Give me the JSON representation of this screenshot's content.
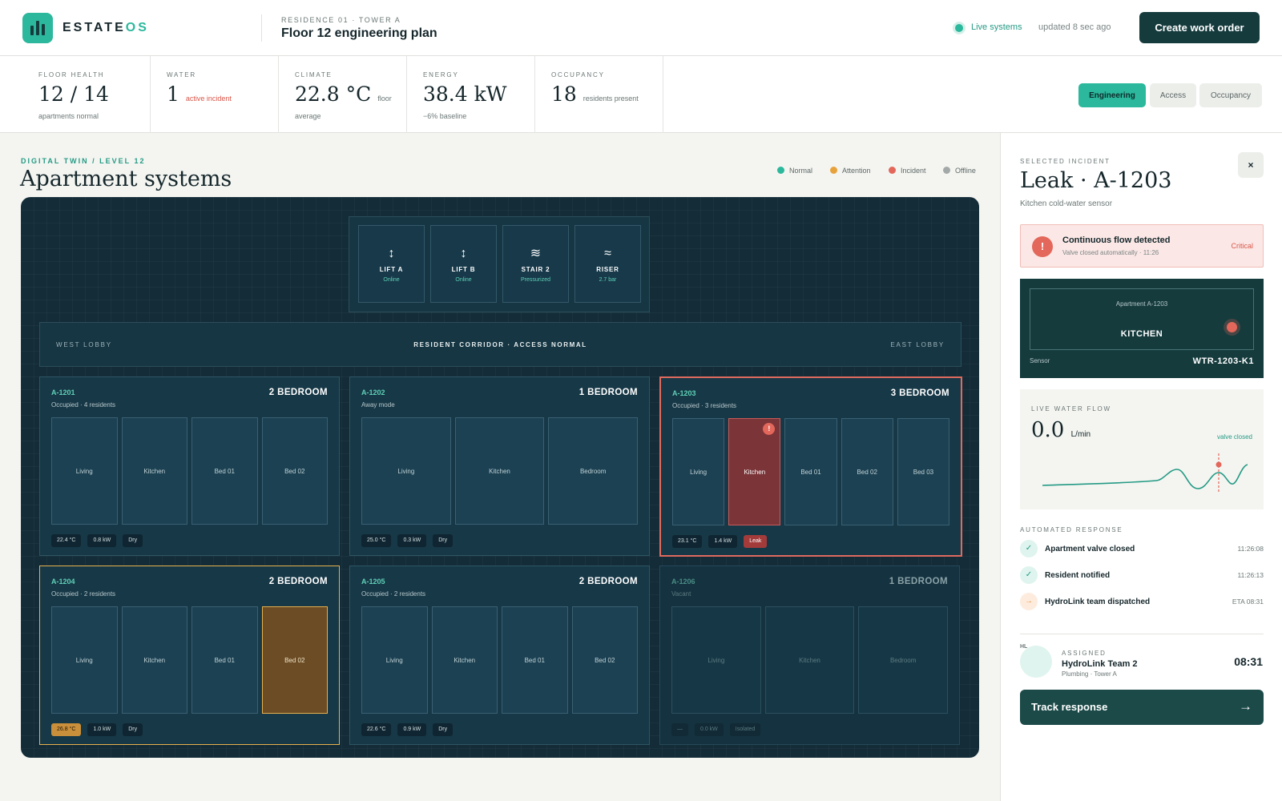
{
  "header": {
    "brand_main": "ESTATE",
    "brand_accent": "OS",
    "crumb": "RESIDENCE 01 · TOWER A",
    "title": "Floor 12 engineering plan",
    "live_label": "Live systems",
    "updated": "updated 8 sec ago",
    "cta": "Create work order"
  },
  "metrics": [
    {
      "label": "FLOOR HEALTH",
      "value": "12 / 14",
      "inline": "",
      "sub": "apartments normal"
    },
    {
      "label": "WATER",
      "value": "1",
      "inline": "active incident",
      "sub": ""
    },
    {
      "label": "CLIMATE",
      "value": "22.8 °C",
      "inline": "floor",
      "sub": "average"
    },
    {
      "label": "ENERGY",
      "value": "38.4 kW",
      "inline": "",
      "sub": "−6% baseline"
    },
    {
      "label": "OCCUPANCY",
      "value": "18",
      "inline": "residents present",
      "sub": ""
    }
  ],
  "view_tabs": [
    "Engineering",
    "Access",
    "Occupancy"
  ],
  "twin": {
    "eyebrow": "DIGITAL TWIN / LEVEL 12",
    "title": "Apartment systems",
    "legend": [
      {
        "label": "Normal",
        "color": "#2bb89c"
      },
      {
        "label": "Attention",
        "color": "#e8a23c"
      },
      {
        "label": "Incident",
        "color": "#e3675a"
      },
      {
        "label": "Offline",
        "color": "#a3a9a8"
      }
    ],
    "core": [
      {
        "icon": "↕",
        "name": "LIFT A",
        "status": "Online"
      },
      {
        "icon": "↕",
        "name": "LIFT B",
        "status": "Online"
      },
      {
        "icon": "≋",
        "name": "STAIR 2",
        "status": "Pressurized"
      },
      {
        "icon": "≈",
        "name": "RISER",
        "status": "2.7 bar"
      }
    ],
    "corridor": {
      "west": "WEST LOBBY",
      "center": "RESIDENT CORRIDOR · ACCESS NORMAL",
      "east": "EAST LOBBY"
    },
    "apartments": [
      {
        "id": "A-1201",
        "status": "Occupied · 4 residents",
        "type": "2 BEDROOM",
        "rooms": [
          "Living",
          "Kitchen",
          "Bed 01",
          "Bed 02"
        ],
        "tags": [
          "22.4 °C",
          "0.8 kW",
          "Dry"
        ]
      },
      {
        "id": "A-1202",
        "status": "Away mode",
        "type": "1 BEDROOM",
        "rooms": [
          "Living",
          "Kitchen",
          "Bedroom"
        ],
        "tags": [
          "25.0 °C",
          "0.3 kW",
          "Dry"
        ]
      },
      {
        "id": "A-1203",
        "status": "Occupied · 3 residents",
        "type": "3 BEDROOM",
        "rooms": [
          "Living",
          "Kitchen",
          "Bed 01",
          "Bed 02",
          "Bed 03"
        ],
        "tags": [
          "23.1 °C",
          "1.4 kW",
          "Leak"
        ],
        "alert_mark": "!"
      },
      {
        "id": "A-1204",
        "status": "Occupied · 2 residents",
        "type": "2 BEDROOM",
        "rooms": [
          "Living",
          "Kitchen",
          "Bed 01",
          "Bed 02"
        ],
        "tags": [
          "26.8 °C",
          "1.0 kW",
          "Dry"
        ]
      },
      {
        "id": "A-1205",
        "status": "Occupied · 2 residents",
        "type": "2 BEDROOM",
        "rooms": [
          "Living",
          "Kitchen",
          "Bed 01",
          "Bed 02"
        ],
        "tags": [
          "22.6 °C",
          "0.9 kW",
          "Dry"
        ]
      },
      {
        "id": "A-1206",
        "status": "Vacant",
        "type": "1 BEDROOM",
        "rooms": [
          "Living",
          "Kitchen",
          "Bedroom"
        ],
        "tags": [
          "—",
          "0.0 kW",
          "Isolated"
        ]
      }
    ]
  },
  "incident": {
    "eyebrow": "SELECTED INCIDENT",
    "title": "Leak · A-1203",
    "subtitle": "Kitchen cold-water sensor",
    "close": "×",
    "alert_icon": "!",
    "alert_title": "Continuous flow detected",
    "alert_sub": "Valve closed automatically · 11:26",
    "alert_level": "Critical",
    "sensor_apartment": "Apartment A-1203",
    "sensor_room": "KITCHEN",
    "sensor_label": "Sensor",
    "sensor_id": "WTR-1203-K1",
    "flow_label": "LIVE WATER FLOW",
    "flow_value": "0.0",
    "flow_unit": "L/min",
    "flow_state": "valve closed",
    "response_label": "AUTOMATED RESPONSE",
    "responses": [
      {
        "icon": "✓",
        "text": "Apartment valve closed",
        "time": "11:26:08"
      },
      {
        "icon": "✓",
        "text": "Resident notified",
        "time": "11:26:13"
      },
      {
        "icon": "→",
        "text": "HydroLink team dispatched",
        "time": "ETA 08:31"
      }
    ],
    "assigned_initials": "HL",
    "assigned_label": "ASSIGNED",
    "assigned_team": "HydroLink Team 2",
    "assigned_sub": "Plumbing · Tower A",
    "assigned_eta": "08:31",
    "track_label": "Track response",
    "track_arrow": "→"
  }
}
